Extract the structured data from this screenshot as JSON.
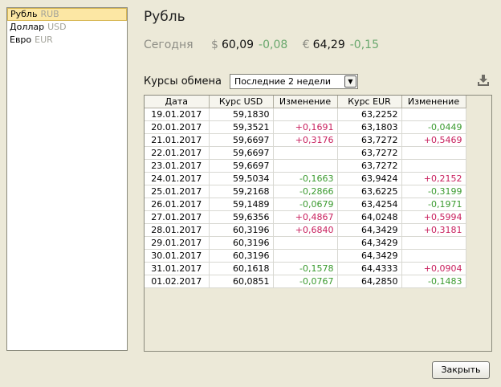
{
  "currencies": [
    {
      "name": "Рубль",
      "code": "RUB",
      "selected": true
    },
    {
      "name": "Доллар",
      "code": "USD",
      "selected": false
    },
    {
      "name": "Евро",
      "code": "EUR",
      "selected": false
    }
  ],
  "title": "Рубль",
  "today": {
    "label": "Сегодня",
    "usd_symbol": "$",
    "usd_rate": "60,09",
    "usd_change": "-0,08",
    "eur_symbol": "€",
    "eur_rate": "64,29",
    "eur_change": "-0,15"
  },
  "rates_label": "Курсы обмена",
  "period": {
    "selected": "Последние 2 недели"
  },
  "table": {
    "headers": [
      "Дата",
      "Курс USD",
      "Изменение",
      "Курс EUR",
      "Изменение"
    ],
    "rows": [
      [
        "19.01.2017",
        "59,1830",
        "",
        "63,2252",
        ""
      ],
      [
        "20.01.2017",
        "59,3521",
        "+0,1691",
        "63,1803",
        "-0,0449"
      ],
      [
        "21.01.2017",
        "59,6697",
        "+0,3176",
        "63,7272",
        "+0,5469"
      ],
      [
        "22.01.2017",
        "59,6697",
        "",
        "63,7272",
        ""
      ],
      [
        "23.01.2017",
        "59,6697",
        "",
        "63,7272",
        ""
      ],
      [
        "24.01.2017",
        "59,5034",
        "-0,1663",
        "63,9424",
        "+0,2152"
      ],
      [
        "25.01.2017",
        "59,2168",
        "-0,2866",
        "63,6225",
        "-0,3199"
      ],
      [
        "26.01.2017",
        "59,1489",
        "-0,0679",
        "63,4254",
        "-0,1971"
      ],
      [
        "27.01.2017",
        "59,6356",
        "+0,4867",
        "64,0248",
        "+0,5994"
      ],
      [
        "28.01.2017",
        "60,3196",
        "+0,6840",
        "64,3429",
        "+0,3181"
      ],
      [
        "29.01.2017",
        "60,3196",
        "",
        "64,3429",
        ""
      ],
      [
        "30.01.2017",
        "60,3196",
        "",
        "64,3429",
        ""
      ],
      [
        "31.01.2017",
        "60,1618",
        "-0,1578",
        "64,4333",
        "+0,0904"
      ],
      [
        "01.02.2017",
        "60,0851",
        "-0,0767",
        "64,2850",
        "-0,1483"
      ]
    ]
  },
  "close_label": "Закрыть",
  "colors": {
    "positive": "#c81e5c",
    "negative": "#3a9a2e",
    "selected_bg": "#fce7a4"
  }
}
